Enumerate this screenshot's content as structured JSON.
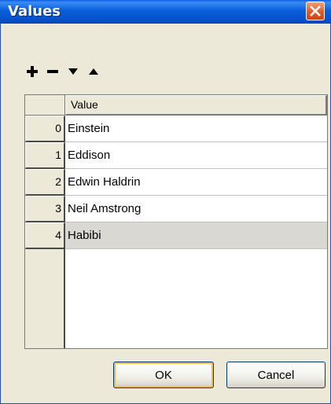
{
  "window": {
    "title": "Values"
  },
  "toolbar": {
    "add_icon": "plus-icon",
    "remove_icon": "minus-icon",
    "down_icon": "triangle-down-icon",
    "up_icon": "triangle-up-icon"
  },
  "table": {
    "column_header": "Value",
    "rows": [
      {
        "index": "0",
        "value": "Einstein"
      },
      {
        "index": "1",
        "value": "Eddison"
      },
      {
        "index": "2",
        "value": "Edwin Haldrin"
      },
      {
        "index": "3",
        "value": "Neil Amstrong"
      },
      {
        "index": "4",
        "value": "Habibi"
      }
    ],
    "selected_row": "4"
  },
  "buttons": {
    "ok_label": "OK",
    "cancel_label": "Cancel"
  },
  "colors": {
    "titlebar": "#0a5fd8",
    "close": "#e05a2a",
    "window_bg": "#ece9d8",
    "selected_row": "#d9d8d3"
  }
}
